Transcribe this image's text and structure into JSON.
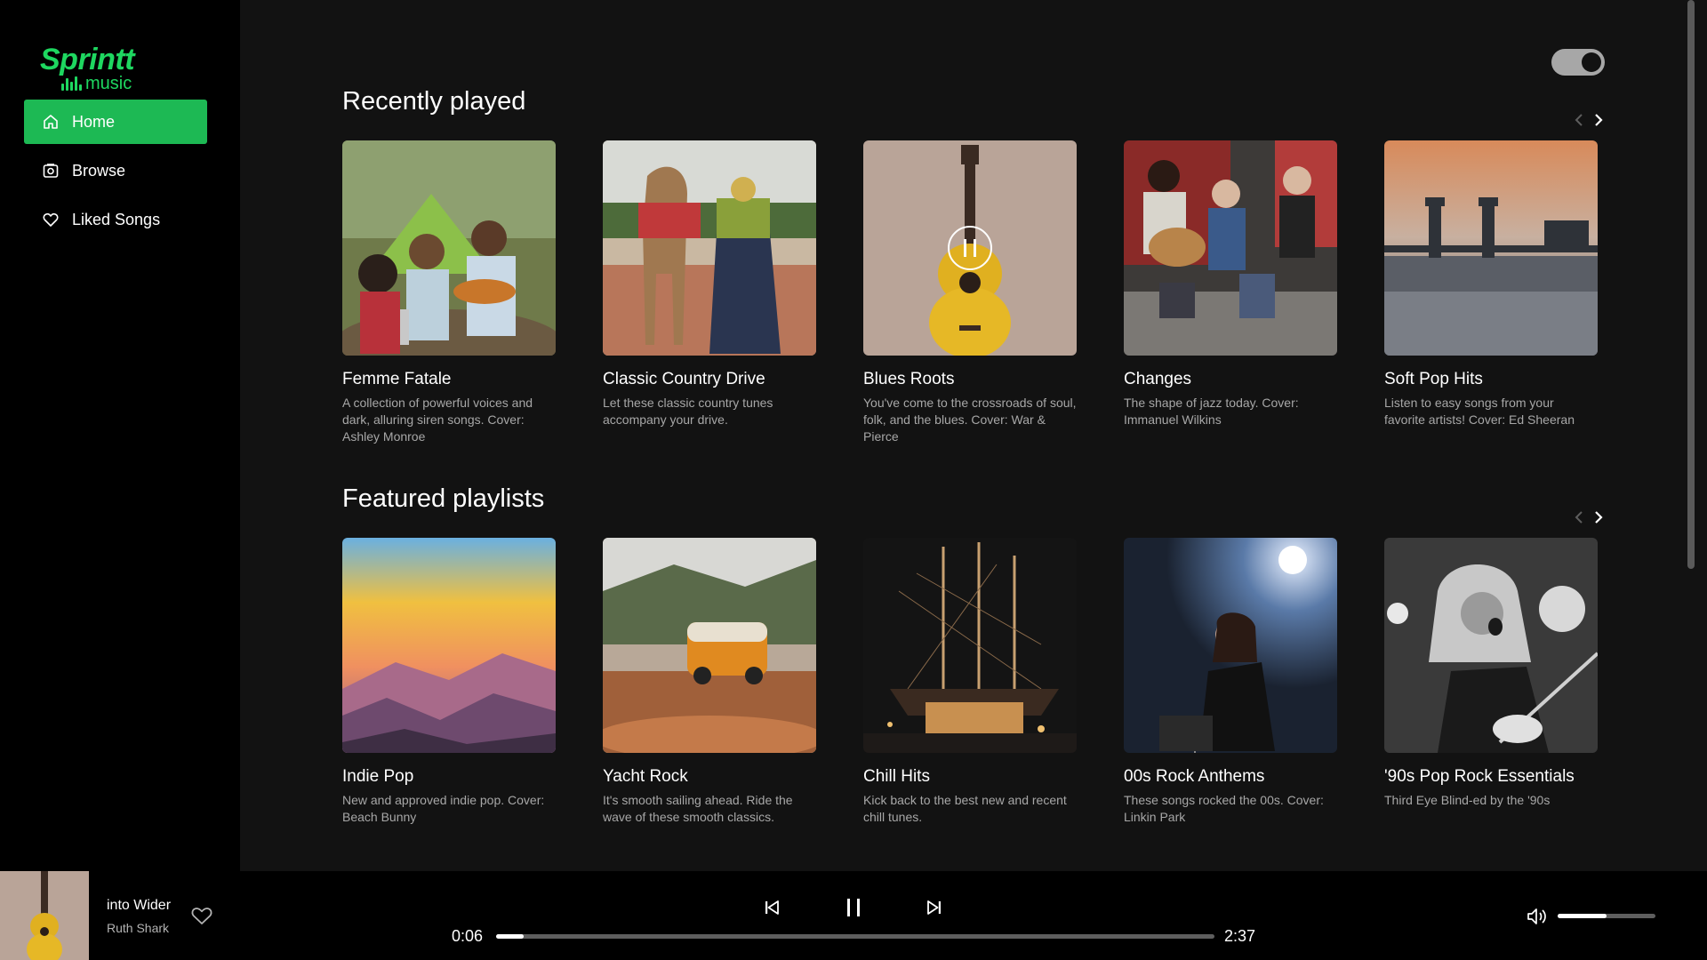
{
  "app": {
    "logo_main": "Sprintt",
    "logo_sub": "music"
  },
  "sidebar": {
    "items": [
      {
        "label": "Home",
        "icon": "home-icon",
        "active": true
      },
      {
        "label": "Browse",
        "icon": "browse-icon",
        "active": false
      },
      {
        "label": "Liked Songs",
        "icon": "heart-icon",
        "active": false
      }
    ]
  },
  "colors": {
    "accent": "#1db954",
    "background": "#121212",
    "sidebar": "#000000",
    "muted_text": "#a7a7a7"
  },
  "header": {
    "theme_toggle_on": true
  },
  "recently_played": {
    "title": "Recently played",
    "cards": [
      {
        "title": "Femme Fatale",
        "desc": "A collection of powerful voices and dark, alluring siren songs. Cover: Ashley Monroe"
      },
      {
        "title": "Classic Country Drive",
        "desc": "Let these classic country tunes accompany your drive."
      },
      {
        "title": "Blues Roots",
        "desc": "You've come to the crossroads of soul, folk, and the blues. Cover: War & Pierce",
        "playing": true
      },
      {
        "title": "Changes",
        "desc": "The shape of jazz today. Cover: Immanuel Wilkins"
      },
      {
        "title": "Soft Pop Hits",
        "desc": "Listen to easy songs from your favorite artists! Cover: Ed Sheeran"
      }
    ]
  },
  "featured_playlists": {
    "title": "Featured playlists",
    "cards": [
      {
        "title": "Indie Pop",
        "desc": "New and approved indie pop. Cover: Beach Bunny"
      },
      {
        "title": "Yacht Rock",
        "desc": "It's smooth sailing ahead. Ride the wave of these smooth classics."
      },
      {
        "title": "Chill Hits",
        "desc": "Kick back to the best new and recent chill tunes."
      },
      {
        "title": "00s Rock Anthems",
        "desc": "These songs rocked the 00s. Cover: Linkin Park"
      },
      {
        "title": "'90s Pop Rock Essentials",
        "desc": "Third Eye Blind-ed by the '90s"
      }
    ]
  },
  "player": {
    "track_title": "into Wider",
    "artist": "Ruth Shark",
    "elapsed": "0:06",
    "duration": "2:37",
    "progress_fraction": 0.038,
    "volume_fraction": 0.5,
    "controls": [
      "previous-icon",
      "pause-icon",
      "next-icon"
    ]
  }
}
